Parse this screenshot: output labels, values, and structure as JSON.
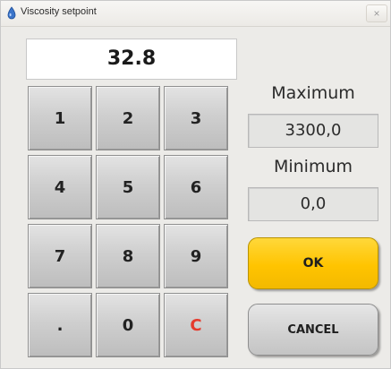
{
  "window": {
    "title": "Viscosity setpoint",
    "icon": "app-icon",
    "close_label": "×"
  },
  "display": {
    "value": "32.8"
  },
  "keypad": {
    "keys": [
      "1",
      "2",
      "3",
      "4",
      "5",
      "6",
      "7",
      "8",
      "9",
      ".",
      "0",
      "C"
    ],
    "clear_color": "#e53a2c"
  },
  "limits": {
    "maximum_label": "Maximum",
    "maximum_value": "3300,0",
    "minimum_label": "Minimum",
    "minimum_value": "0,0"
  },
  "actions": {
    "ok_label": "OK",
    "cancel_label": "CANCEL",
    "ok_color": "#ffc400"
  }
}
